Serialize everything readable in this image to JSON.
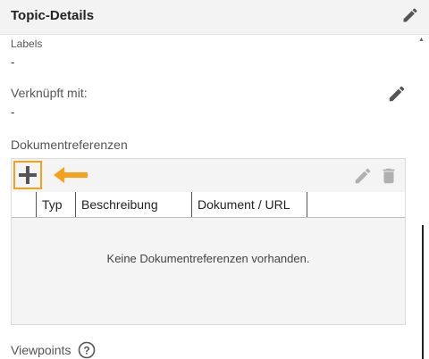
{
  "header": {
    "title": "Topic-Details"
  },
  "labels": {
    "label": "Labels",
    "value": "-"
  },
  "linked": {
    "label": "Verknüpft mit:",
    "value": "-"
  },
  "documents": {
    "section_label": "Dokumentreferenzen",
    "columns": [
      "Typ",
      "Beschreibung",
      "Dokument / URL"
    ],
    "empty_message": "Keine Dokumentreferenzen vorhanden.",
    "highlight_color": "#f5a11c"
  },
  "viewpoints": {
    "label": "Viewpoints"
  },
  "colors": {
    "header_bg": "#f3f3f3",
    "icon_dark": "#555555",
    "icon_disabled": "#b0b0b0"
  },
  "icons": [
    "pencil-icon",
    "plus-icon",
    "arrow-left-icon",
    "trash-icon",
    "help-circle-icon"
  ]
}
